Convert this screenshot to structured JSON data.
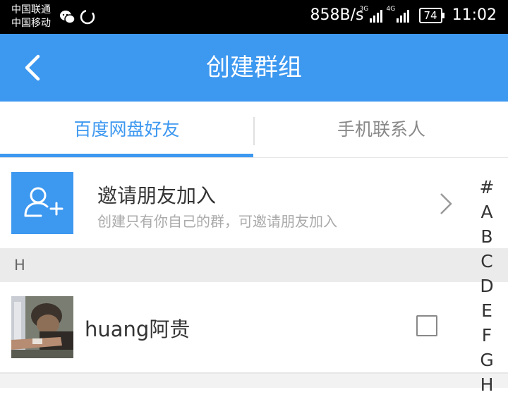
{
  "status_bar": {
    "carrier_1": "中国联通",
    "carrier_2": "中国移动",
    "left_icons": [
      "wechat-icon",
      "loading-circle-icon"
    ],
    "speed": "858B/s",
    "net_1": "3G",
    "net_2": "4G",
    "battery": "74",
    "time": "11:02"
  },
  "header": {
    "title": "创建群组",
    "back_icon": "back-arrow-icon",
    "bg_color": "#3d98f0"
  },
  "tabs": [
    {
      "label": "百度网盘好友",
      "selected": true
    },
    {
      "label": "手机联系人",
      "selected": false
    }
  ],
  "invite": {
    "title": "邀请朋友加入",
    "subtitle": "创建只有你自己的群，可邀请朋友加入",
    "icon": "add-user-icon"
  },
  "section_header": "H",
  "contacts": [
    {
      "name": "huang阿贵",
      "checked": false
    }
  ],
  "index_bar": [
    "#",
    "A",
    "B",
    "C",
    "D",
    "E",
    "F",
    "G",
    "H"
  ],
  "accent_color": "#3d98f0"
}
